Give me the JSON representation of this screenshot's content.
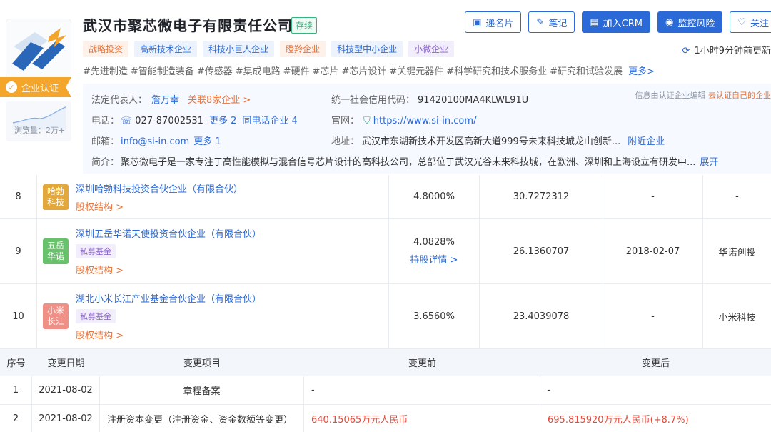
{
  "company": {
    "name": "武汉市聚芯微电子有限责任公司",
    "status": "存续"
  },
  "actions": [
    {
      "icon": "card-icon",
      "glyph": "▣",
      "label": "递名片"
    },
    {
      "icon": "note-icon",
      "glyph": "✎",
      "label": "笔记"
    },
    {
      "icon": "crm-icon",
      "glyph": "▤",
      "label": "加入CRM"
    },
    {
      "icon": "monitor-icon",
      "glyph": "◉",
      "label": "监控风险"
    },
    {
      "icon": "heart-icon",
      "glyph": "♡",
      "label": "关注"
    }
  ],
  "tags": [
    {
      "label": "战略投资",
      "style": "orange"
    },
    {
      "label": "高新技术企业",
      "style": "blue"
    },
    {
      "label": "科技小巨人企业",
      "style": "blue"
    },
    {
      "label": "瞪羚企业",
      "style": "orange"
    },
    {
      "label": "科技型中小企业",
      "style": "blue"
    },
    {
      "label": "小微企业",
      "style": "purple"
    }
  ],
  "update_time": "1小时9分钟前更新",
  "industry_tags": [
    "#先进制造",
    "#智能制造装备",
    "#传感器",
    "#集成电路",
    "#硬件",
    "#芯片",
    "#芯片设计",
    "#关键元器件",
    "#科学研究和技术服务业",
    "#研究和试验发展"
  ],
  "industry_more": "更多>",
  "certification": "企业认证",
  "views_label": "浏览量：2万+",
  "info": {
    "legal_rep_label": "法定代表人：",
    "legal_rep": "詹万幸",
    "related": "关联8家企业 >",
    "credit_code_label": "统一社会信用代码：",
    "credit_code": "91420100MA4KLWL91U",
    "note": "信息由认证企业编辑",
    "note_link": "去认证自己的企业",
    "phone_label": "电话：",
    "phone": "027-87002531",
    "phone_more": "更多 2",
    "phone_same": "同电话企业 4",
    "website_label": "官网：",
    "website": "https://www.si-in.com/",
    "email_label": "邮箱：",
    "email": "info@si-in.com",
    "email_more": "更多 1",
    "address_label": "地址：",
    "address": "武汉市东湖新技术开发区高新大道999号未来科技城龙山创新...",
    "address_link": "附近企业",
    "intro_label": "简介：",
    "intro": "聚芯微电子是一家专注于高性能模拟与混合信号芯片设计的高科技公司，总部位于武汉光谷未来科技城，在欧洲、深圳和上海设立有研发中...",
    "intro_link": "展开"
  },
  "shareholders": [
    {
      "index": "8",
      "avatar": "哈勃科技",
      "avatar_color": "#e3a83b",
      "name": "深圳哈勃科技投资合伙企业（有限合伙）",
      "tag": "",
      "sub": "股权结构 >",
      "percent": "4.8000%",
      "percent_link": "",
      "amount": "30.7272312",
      "date": "-",
      "related": "-"
    },
    {
      "index": "9",
      "avatar": "五岳华诺",
      "avatar_color": "#67c26b",
      "name": "深圳五岳华诺天使投资合伙企业（有限合伙）",
      "tag": "私募基金",
      "sub": "股权结构 >",
      "percent": "4.0828%",
      "percent_link": "持股详情 >",
      "amount": "26.1360707",
      "date": "2018-02-07",
      "related": "华诺创投"
    },
    {
      "index": "10",
      "avatar": "小米长江",
      "avatar_color": "#ef8f86",
      "name": "湖北小米长江产业基金合伙企业（有限合伙）",
      "tag": "私募基金",
      "sub": "股权结构 >",
      "percent": "3.6560%",
      "percent_link": "",
      "amount": "23.4039078",
      "date": "-",
      "related": "小米科技"
    }
  ],
  "changes": {
    "headers": [
      "序号",
      "变更日期",
      "变更项目",
      "变更前",
      "变更后"
    ],
    "rows": [
      {
        "index": "1",
        "date": "2021-08-02",
        "item": "章程备案",
        "before": "-",
        "after": "-"
      },
      {
        "index": "2",
        "date": "2021-08-02",
        "item": "注册资本变更（注册资金、资金数额等变更）",
        "before": "640.15065万元人民币",
        "after": "695.815920万元人民币(+8.7%)"
      }
    ]
  }
}
